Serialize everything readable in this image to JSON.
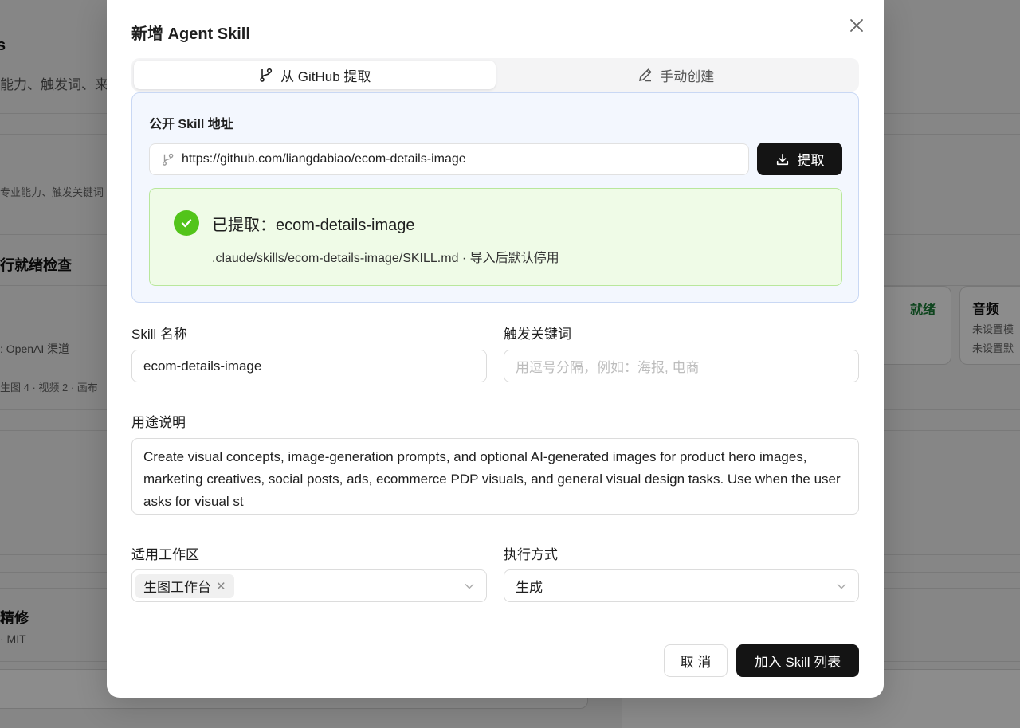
{
  "background": {
    "texts": [
      {
        "key": "s",
        "text": "s"
      },
      {
        "key": "desc1",
        "text": "能力、触发词、来"
      },
      {
        "key": "desc2",
        "text": "专业能力、触发关键词"
      },
      {
        "key": "ready_check",
        "text": "行就绪检查"
      },
      {
        "key": "openai",
        "text": ": OpenAI 渠道"
      },
      {
        "key": "counts",
        "text": "生图 4 · 视频 2 · 画布"
      },
      {
        "key": "retouch",
        "text": "精修"
      },
      {
        "key": "mit",
        "text": "· MIT"
      },
      {
        "key": "ready_badge",
        "text": "就绪"
      },
      {
        "key": "audio",
        "text": "音频"
      },
      {
        "key": "unset1",
        "text": "未设置模"
      },
      {
        "key": "unset2",
        "text": "未设置默"
      }
    ]
  },
  "modal": {
    "title": "新增 Agent Skill",
    "tabs": [
      {
        "key": "github",
        "label": "从 GitHub 提取",
        "active": true,
        "icon": "git-branch-icon"
      },
      {
        "key": "manual",
        "label": "手动创建",
        "active": false,
        "icon": "pencil-icon"
      }
    ],
    "github": {
      "label": "公开 Skill 地址",
      "url": "https://github.com/liangdabiao/ecom-details-image",
      "fetch_label": "提取",
      "success": {
        "title": "已提取：ecom-details-image",
        "subtitle": ".claude/skills/ecom-details-image/SKILL.md · 导入后默认停用"
      }
    },
    "form": {
      "name_label": "Skill 名称",
      "name_value": "ecom-details-image",
      "keywords_label": "触发关键词",
      "keywords_placeholder": "用逗号分隔，例如：海报, 电商",
      "desc_label": "用途说明",
      "desc_value": "Create visual concepts, image-generation prompts, and optional AI-generated images for product hero images, marketing creatives, social posts, ads, ecommerce PDP visuals, and general visual design tasks. Use when the user asks for visual st",
      "workspace_label": "适用工作区",
      "workspace_tags": [
        "生图工作台"
      ],
      "exec_label": "执行方式",
      "exec_value": "生成"
    },
    "actions": {
      "cancel": "取 消",
      "submit": "加入 Skill 列表"
    }
  },
  "colors": {
    "primary": "#141414",
    "success": "#52c41a",
    "success_bg": "#effbe7",
    "panel_bg": "#f3f7fe"
  }
}
